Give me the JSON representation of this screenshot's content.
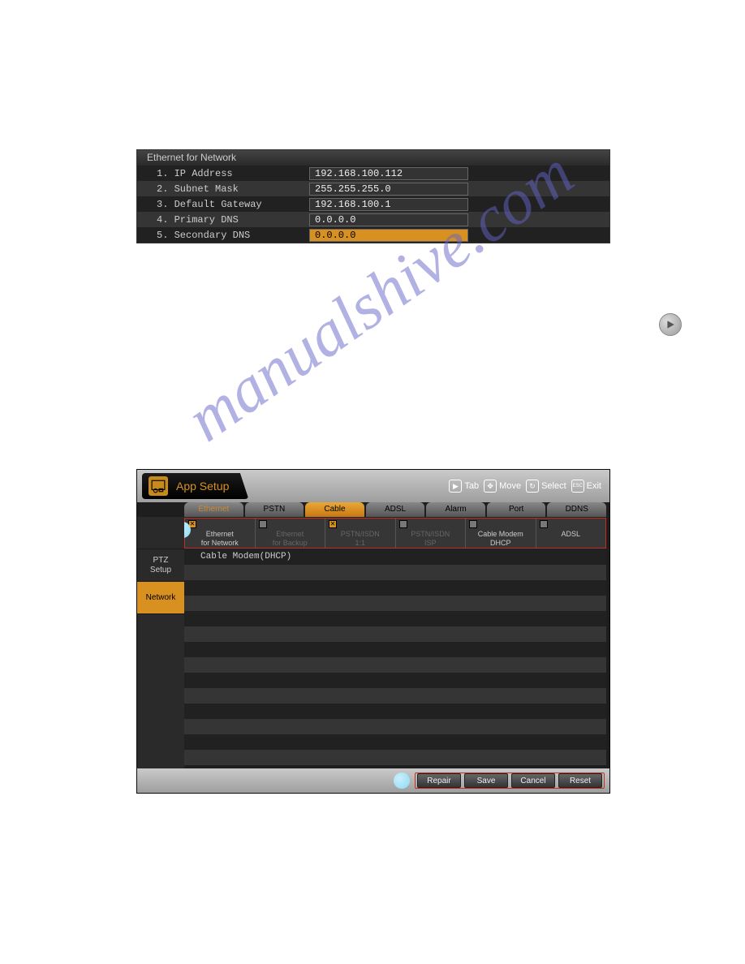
{
  "panel1": {
    "header": "Ethernet for Network",
    "rows": [
      {
        "label": "1. IP Address",
        "value": "192.168.100.112"
      },
      {
        "label": "2. Subnet Mask",
        "value": "255.255.255.0"
      },
      {
        "label": "3. Default Gateway",
        "value": "192.168.100.1"
      },
      {
        "label": "4. Primary DNS",
        "value": "0.0.0.0"
      },
      {
        "label": "5. Secondary DNS",
        "value": "0.0.0.0"
      }
    ]
  },
  "watermark": "manualshive.com",
  "panel2": {
    "title": "App Setup",
    "hints": {
      "tab": "Tab",
      "move": "Move",
      "select": "Select",
      "exit": "Exit",
      "esc": "ESC"
    },
    "tabs": [
      "Ethernet",
      "PSTN",
      "Cable",
      "ADSL",
      "Alarm",
      "Port",
      "DDNS"
    ],
    "active_tab_index": 2,
    "conn_items": [
      {
        "label": "Ethernet\nfor Network",
        "checked": true,
        "dim": false
      },
      {
        "label": "Ethernet\nfor Backup",
        "checked": false,
        "dim": true
      },
      {
        "label": "PSTN/ISDN\n1:1",
        "checked": true,
        "dim": true
      },
      {
        "label": "PSTN/ISDN\nISP",
        "checked": false,
        "dim": true
      },
      {
        "label": "Cable Modem\nDHCP",
        "checked": false,
        "dim": false
      },
      {
        "label": "ADSL",
        "checked": false,
        "dim": false
      }
    ],
    "sidebar": [
      {
        "label": "PTZ\nSetup",
        "active": false
      },
      {
        "label": "Network",
        "active": true
      }
    ],
    "content_header": "Cable Modem(DHCP)",
    "footer_buttons": [
      "Repair",
      "Save",
      "Cancel",
      "Reset"
    ]
  }
}
